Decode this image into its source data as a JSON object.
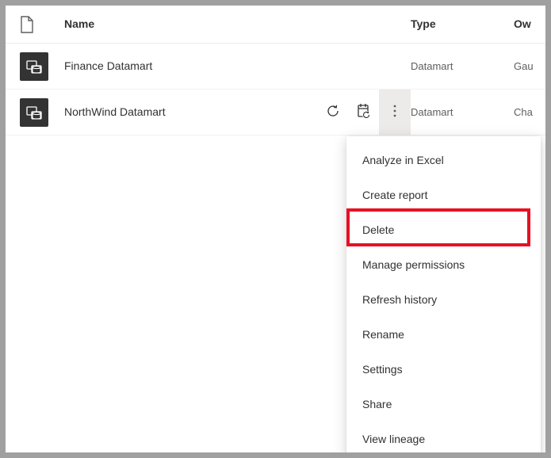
{
  "columns": {
    "name": "Name",
    "type": "Type",
    "owner": "Ow"
  },
  "rows": [
    {
      "name": "Finance Datamart",
      "type": "Datamart",
      "owner": "Gau"
    },
    {
      "name": "NorthWind Datamart",
      "type": "Datamart",
      "owner": "Cha"
    }
  ],
  "menu": {
    "analyze": "Analyze in Excel",
    "create_report": "Create report",
    "delete": "Delete",
    "manage_permissions": "Manage permissions",
    "refresh_history": "Refresh history",
    "rename": "Rename",
    "settings": "Settings",
    "share": "Share",
    "view_lineage": "View lineage"
  }
}
